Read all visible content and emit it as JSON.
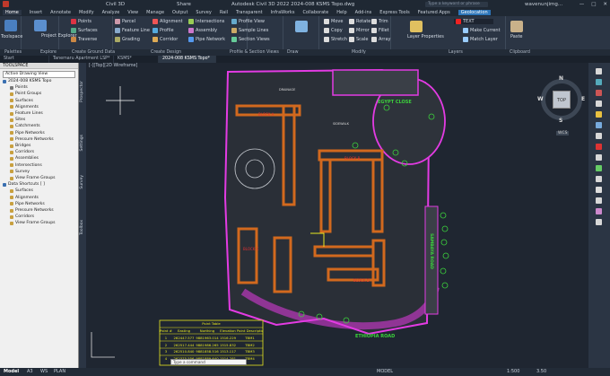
{
  "titlebar": {
    "app": "Civil 3D",
    "share": "Share",
    "title": "Autodesk Civil 3D 2022    2024-008 KSMS Topo.dwg",
    "search_placeholder": "Type a keyword or phrase",
    "user": "wavenunjimg..."
  },
  "menu": [
    "Home",
    "Insert",
    "Annotate",
    "Modify",
    "Analyze",
    "View",
    "Manage",
    "Output",
    "Survey",
    "Rail",
    "Transparent",
    "InfraWorks",
    "Collaborate",
    "Help",
    "Add-ins",
    "Express Tools",
    "Featured Apps",
    "Geolocation"
  ],
  "ribbon": {
    "toolspace": "Toolspace",
    "project_explorer": "Project Explorer",
    "points": "Points",
    "surfaces": "Surfaces",
    "traverse": "Traverse",
    "parcel": "Parcel",
    "feature_line": "Feature Line",
    "grading": "Grading",
    "alignment": "Alignment",
    "profile": "Profile",
    "corridor": "Corridor",
    "intersections": "Intersections",
    "assembly": "Assembly",
    "pipe_network": "Pipe Network",
    "profile_view": "Profile View",
    "sample_lines": "Sample Lines",
    "section_views": "Section Views",
    "draw": "Draw",
    "move": "Move",
    "copy": "Copy",
    "stretch": "Stretch",
    "rotate": "Rotate",
    "mirror": "Mirror",
    "scale": "Scale",
    "trim": "Trim",
    "fillet": "Fillet",
    "array": "Array",
    "layer_properties": "Layer Properties",
    "layer_current": "TEXT",
    "make_current": "Make Current",
    "match_layer": "Match Layer",
    "paste": "Paste"
  },
  "panels": [
    "Palettes",
    "Explore",
    "Create Ground Data",
    "Create Design",
    "Profile & Section Views",
    "Draw",
    "Modify",
    "Layers",
    "Clipboard"
  ],
  "doc_tabs": [
    "Start",
    "Tanemaru Apartment LSP*",
    "KSMS*",
    "2024-008 KSMS Topo*"
  ],
  "toolspace": {
    "title": "TOOLSPACE",
    "view": "Active Drawing View",
    "tree": [
      {
        "label": "2024-008 KSMS Topo",
        "level": 0,
        "color": "#3a6fb0"
      },
      {
        "label": "Points",
        "level": 2,
        "color": "#777777"
      },
      {
        "label": "Point Groups",
        "level": 2,
        "color": "#c8a040"
      },
      {
        "label": "Surfaces",
        "level": 2,
        "color": "#c8a040"
      },
      {
        "label": "Alignments",
        "level": 2,
        "color": "#c8a040"
      },
      {
        "label": "Feature Lines",
        "level": 2,
        "color": "#c8a040"
      },
      {
        "label": "Sites",
        "level": 2,
        "color": "#c8a040"
      },
      {
        "label": "Catchments",
        "level": 2,
        "color": "#c8a040"
      },
      {
        "label": "Pipe Networks",
        "level": 2,
        "color": "#c8a040"
      },
      {
        "label": "Pressure Networks",
        "level": 2,
        "color": "#c8a040"
      },
      {
        "label": "Bridges",
        "level": 2,
        "color": "#c8a040"
      },
      {
        "label": "Corridors",
        "level": 2,
        "color": "#c8a040"
      },
      {
        "label": "Assemblies",
        "level": 2,
        "color": "#c8a040"
      },
      {
        "label": "Intersections",
        "level": 2,
        "color": "#c8a040"
      },
      {
        "label": "Survey",
        "level": 2,
        "color": "#c8a040"
      },
      {
        "label": "View Frame Groups",
        "level": 2,
        "color": "#c8a040"
      },
      {
        "label": "Data Shortcuts [ ]",
        "level": 0,
        "color": "#3a6fb0"
      },
      {
        "label": "Surfaces",
        "level": 2,
        "color": "#c8a040"
      },
      {
        "label": "Alignments",
        "level": 2,
        "color": "#c8a040"
      },
      {
        "label": "Pipe Networks",
        "level": 2,
        "color": "#c8a040"
      },
      {
        "label": "Pressure Networks",
        "level": 2,
        "color": "#c8a040"
      },
      {
        "label": "Corridors",
        "level": 2,
        "color": "#c8a040"
      },
      {
        "label": "View Frame Groups",
        "level": 2,
        "color": "#c8a040"
      }
    ]
  },
  "side_tabs": [
    "Prospector",
    "Settings",
    "Survey",
    "Toolbox"
  ],
  "viewport": {
    "label": "[-][Top][2D Wireframe]",
    "compass": {
      "n": "N",
      "s": "S",
      "e": "E",
      "w": "W",
      "top": "TOP"
    },
    "ucs": "WCS",
    "roads": [
      "EGYPT CLOSE",
      "ETHIOPIA ROAD",
      "SAMBAYA ROAD"
    ],
    "blocks": [
      "BLOCK A",
      "BLOCK B",
      "BLOCK C",
      "BLOCK D"
    ],
    "drainage": "DRAINAGE",
    "sidewalk": "SIDEWALK",
    "table": {
      "title": "Point Table",
      "headers": [
        "Point #",
        "Easting",
        "Northing",
        "Elevation",
        "Point Description"
      ],
      "rows": [
        [
          "1",
          "262447.577",
          "9881963.014",
          "1516.229",
          "TBM1"
        ],
        [
          "2",
          "262517.444",
          "9881986.265",
          "1515.832",
          "TBM2"
        ],
        [
          "3",
          "262510.840",
          "9881858.516",
          "1513.117",
          "TBM3"
        ],
        [
          "4",
          "262375.556",
          "9881889.640",
          "1514.281",
          "TBM4"
        ]
      ]
    }
  },
  "colors": {
    "magenta": "#e33be3",
    "orange": "#d2691e",
    "green": "#3cd23c",
    "table_yellow": "#e8e820"
  },
  "status": {
    "layouts": [
      "Model",
      "A3",
      "WS",
      "PLAN"
    ],
    "command": "Type a command",
    "mode": "MODEL",
    "scale": "1:500",
    "elev": "3.50"
  }
}
